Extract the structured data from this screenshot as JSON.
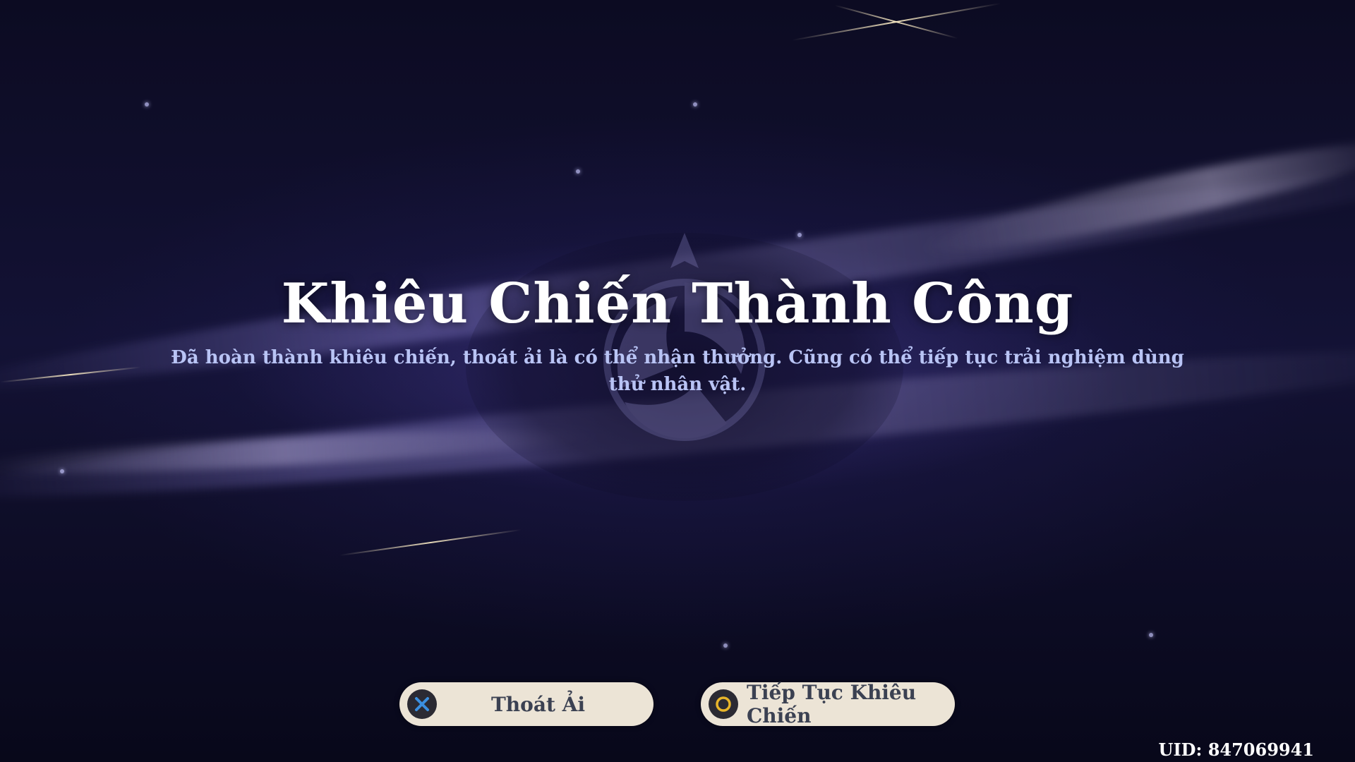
{
  "result": {
    "title": "Khiêu Chiến Thành Công",
    "message": "Đã hoàn thành khiêu chiến, thoát ải là có thể nhận thưởng. Cũng có thể tiếp tục trải nghiệm dùng thử nhân vật."
  },
  "actions": {
    "exit": {
      "label": "Thoát Ải",
      "icon": "cross-button-icon",
      "icon_color": "#3b8fe0"
    },
    "continue": {
      "label": "Tiếp Tục Khiêu Chiến",
      "icon": "circle-button-icon",
      "icon_color": "#e8b52a"
    }
  },
  "footer": {
    "uid": "UID: 847069941"
  },
  "colors": {
    "background": "#0b0a1f",
    "title": "#ffffff",
    "message": "#b9c4f5",
    "button_bg": "#ece4d6",
    "button_text": "#3b4152"
  }
}
